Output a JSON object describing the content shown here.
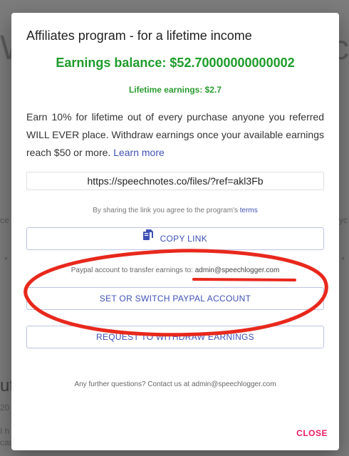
{
  "background": {
    "left_heading": "W",
    "right_heading": "c",
    "left_fragment1": "ce",
    "right_fragment1": "yc",
    "left_fragment2": "*",
    "right_fragment2": "*",
    "left_heading2": "ut",
    "left_date": "20",
    "left_text1": "I h",
    "left_text2": "cau"
  },
  "dialog": {
    "title": "Affiliates program - for a lifetime income",
    "balance": "Earnings balance: $52.70000000000002",
    "lifetime": "Lifetime earnings: $2.7",
    "description": "Earn 10% for lifetime out of every purchase anyone you referred WILL EVER place. Withdraw earnings once your available earnings reach $50 or more.",
    "learn_more": "Learn more",
    "referral_link": "https://speechnotes.co/files/?ref=akl3Fb",
    "agree_prefix": "By sharing the link you agree to the program's",
    "agree_link": "terms",
    "copy_label": "COPY LINK",
    "paypal_prefix": "Paypal account to transfer earnings to:",
    "paypal_email": "admin@speechlogger.com",
    "switch_label": "SET OR SWITCH PAYPAL ACCOUNT",
    "withdraw_label": "REQUEST TO WITHDRAW EARNINGS",
    "questions": "Any further questions? Contact us at admin@speechlogger.com",
    "close_label": "CLOSE"
  },
  "colors": {
    "accent": "#3f51b5",
    "balance_green": "#1e9b2a",
    "close_pink": "#e91e63",
    "annotation_red": "#e8281c"
  },
  "icons": {
    "copy": "copy-icon"
  }
}
